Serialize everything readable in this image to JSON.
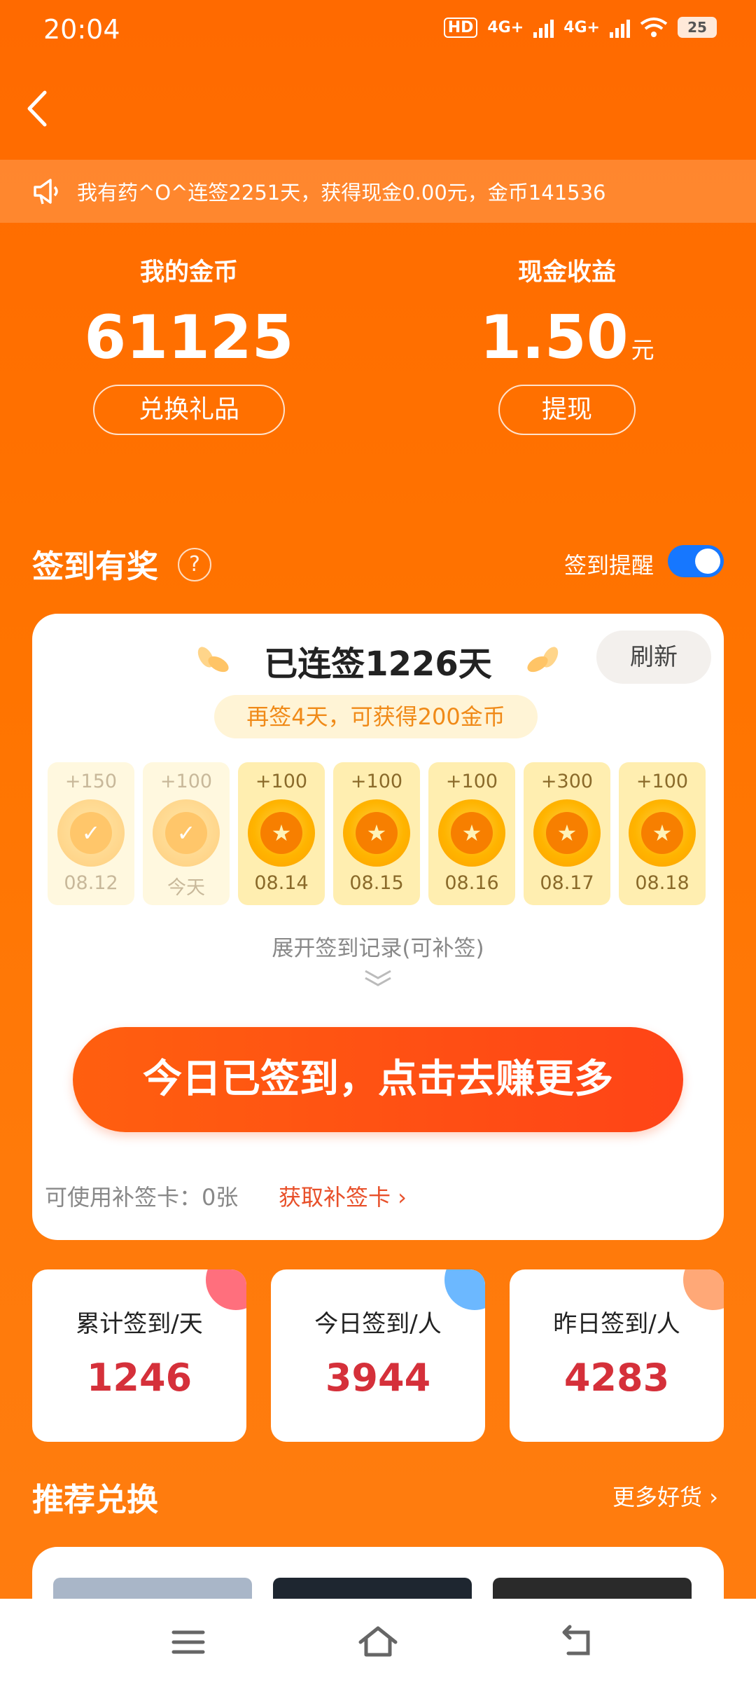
{
  "status_bar": {
    "time": "20:04",
    "network_1": "4G+",
    "network_2": "4G+",
    "hd": "HD",
    "battery": "25"
  },
  "notice": {
    "text": "我有药^O^连签2251天，获得现金0.00元，金币141536"
  },
  "coins": {
    "title": "我的金币",
    "value": "61125",
    "button": "兑换礼品"
  },
  "cash": {
    "title": "现金收益",
    "value": "1.50",
    "unit": "元",
    "button": "提现"
  },
  "checkin_section": {
    "title": "签到有奖",
    "help_symbol": "?",
    "remind_label": "签到提醒",
    "remind_on": true
  },
  "sign_card": {
    "streak_title": "已连签1226天",
    "refresh": "刷新",
    "tip": "再签4天，可获得200金币",
    "days": [
      {
        "points": "+150",
        "date": "08.12",
        "done": true
      },
      {
        "points": "+100",
        "date": "今天",
        "done": true
      },
      {
        "points": "+100",
        "date": "08.14",
        "done": false
      },
      {
        "points": "+100",
        "date": "08.15",
        "done": false
      },
      {
        "points": "+100",
        "date": "08.16",
        "done": false
      },
      {
        "points": "+300",
        "date": "08.17",
        "done": false
      },
      {
        "points": "+100",
        "date": "08.18",
        "done": false
      }
    ],
    "expand_text": "展开签到记录(可补签)",
    "cta": "今日已签到，点击去赚更多",
    "makeup_label": "可使用补签卡：0张",
    "makeup_link": "获取补签卡 ›"
  },
  "stat_cards": [
    {
      "label": "累计签到/天",
      "value": "1246",
      "corner_color": "#ff6f7d"
    },
    {
      "label": "今日签到/人",
      "value": "3944",
      "corner_color": "#6cb8ff"
    },
    {
      "label": "昨日签到/人",
      "value": "4283",
      "corner_color": "#ffa877"
    }
  ],
  "recommend": {
    "title": "推荐兑换",
    "more": "更多好货 ›"
  },
  "colors": {
    "accent": "#ff6a00",
    "value_red": "#d5303a",
    "toggle_blue": "#1677ff"
  }
}
